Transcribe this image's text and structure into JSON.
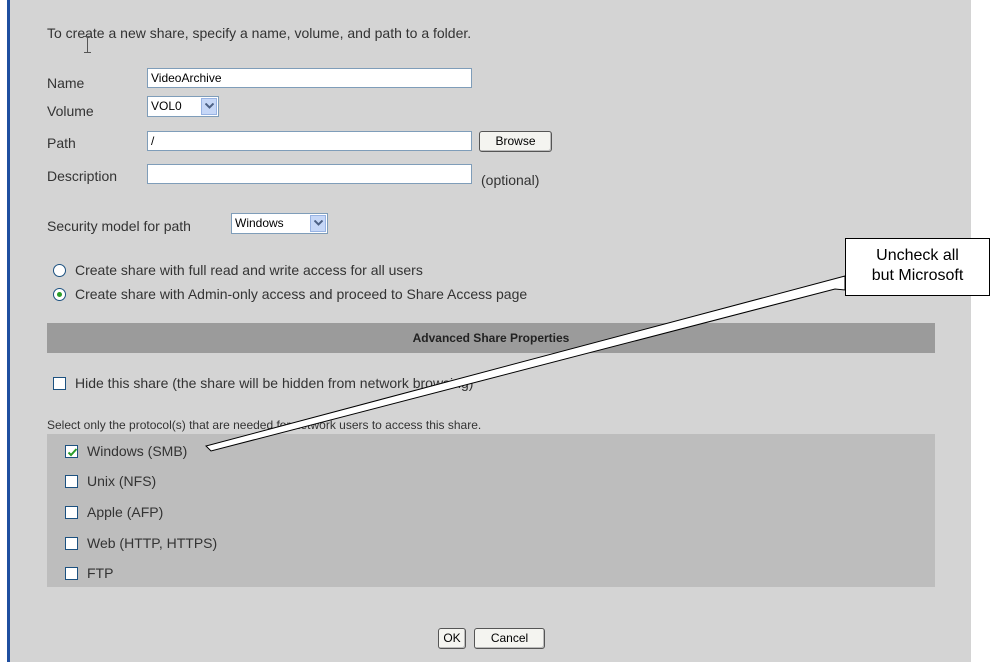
{
  "form": {
    "intro": "To create a new share, specify a name, volume, and path to a folder.",
    "name_label": "Name",
    "name_value": "VideoArchive",
    "volume_label": "Volume",
    "volume_value": "VOL0",
    "path_label": "Path",
    "path_value": "/",
    "browse_label": "Browse",
    "description_label": "Description",
    "description_value": "",
    "optional_note": "(optional)",
    "security_label": "Security model for path",
    "security_value": "Windows"
  },
  "access_options": [
    {
      "label": "Create share with full read and write access for all users",
      "selected": false
    },
    {
      "label": "Create share with Admin-only access and proceed to Share Access page",
      "selected": true
    }
  ],
  "advanced": {
    "header": "Advanced Share Properties",
    "hide_label": "Hide this share (the share will be hidden from network browsing)",
    "hide_checked": false,
    "protocol_prompt": "Select only the protocol(s) that are needed for network users to access this share.",
    "protocols": [
      {
        "label": "Windows (SMB)",
        "checked": true
      },
      {
        "label": "Unix (NFS)",
        "checked": false
      },
      {
        "label": "Apple (AFP)",
        "checked": false
      },
      {
        "label": "Web (HTTP, HTTPS)",
        "checked": false
      },
      {
        "label": "FTP",
        "checked": false
      }
    ]
  },
  "actions": {
    "ok_label": "OK",
    "cancel_label": "Cancel"
  },
  "callout": {
    "line1": "Uncheck all",
    "line2": "but Microsoft"
  },
  "colors": {
    "panel": "#d4d4d4",
    "header": "#9b9b9b",
    "protocol_box": "#bdbdbd",
    "check_green": "#2a9d2a"
  }
}
